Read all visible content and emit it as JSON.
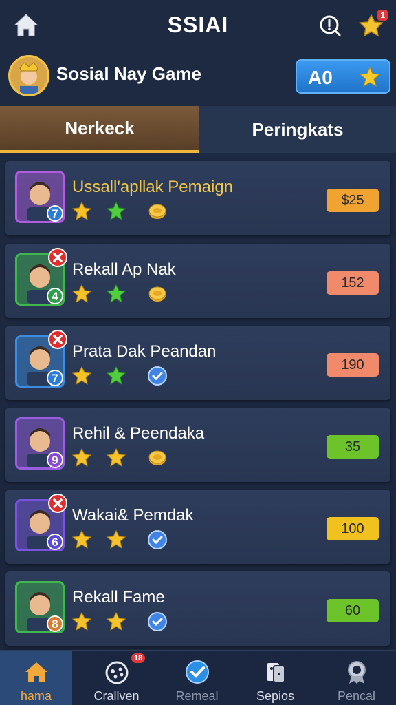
{
  "header": {
    "title": "SSIAI",
    "notif_badge": "1"
  },
  "profile": {
    "game_name": "Sosial Nay Game",
    "coin_value": "A0"
  },
  "tabs": [
    {
      "label": "Nerkeck",
      "active": true
    },
    {
      "label": "Peringkats",
      "active": false
    }
  ],
  "players": [
    {
      "name": "Ussall'apllak Pemaign",
      "level": "7",
      "score": "$25",
      "score_color": "#f1a331",
      "name_color": "#f2c84a",
      "has_x": false,
      "frame": "#b25ce0",
      "lvl_color": "#2a7dd8",
      "icons": [
        "star-gold",
        "star-green",
        "coin-gold"
      ]
    },
    {
      "name": "Rekall Ap Nak",
      "level": "4",
      "score": "152",
      "score_color": "#f08a6a",
      "name_color": "#ffffff",
      "has_x": true,
      "frame": "#3eb84a",
      "lvl_color": "#2ba048",
      "icons": [
        "star-gold",
        "star-green",
        "coin-gold"
      ]
    },
    {
      "name": "Prata Dak Peandan",
      "level": "7",
      "score": "190",
      "score_color": "#f08a6a",
      "name_color": "#ffffff",
      "has_x": true,
      "frame": "#3a8de0",
      "lvl_color": "#2a7dd8",
      "icons": [
        "star-gold",
        "star-green",
        "check-blue"
      ]
    },
    {
      "name": "Rehil & Peendaka",
      "level": "9",
      "score": "35",
      "score_color": "#6cc42a",
      "name_color": "#ffffff",
      "has_x": false,
      "frame": "#9a5ce0",
      "lvl_color": "#8a48d8",
      "icons": [
        "star-gold",
        "star-gold",
        "coin-gold"
      ]
    },
    {
      "name": "Wakai& Pemdak",
      "level": "6",
      "score": "100",
      "score_color": "#f1c21f",
      "name_color": "#ffffff",
      "has_x": true,
      "frame": "#7a54e0",
      "lvl_color": "#5a48d8",
      "icons": [
        "star-gold",
        "star-gold",
        "check-blue"
      ]
    },
    {
      "name": "Rekall Fame",
      "level": "8",
      "score": "60",
      "score_color": "#6cc42a",
      "name_color": "#ffffff",
      "has_x": false,
      "frame": "#3eb84a",
      "lvl_color": "#e07a2a",
      "icons": [
        "star-gold",
        "star-gold",
        "check-blue"
      ]
    }
  ],
  "nav": [
    {
      "label": "hama",
      "icon": "home-icon",
      "active": true
    },
    {
      "label": "Crallven",
      "icon": "gamepad-icon",
      "active": false,
      "badge": "18"
    },
    {
      "label": "Remeal",
      "icon": "check-circle-icon",
      "active": false
    },
    {
      "label": "Sepios",
      "icon": "cards-icon",
      "active": false
    },
    {
      "label": "Pencal",
      "icon": "medal-icon",
      "active": false
    }
  ],
  "colors": {
    "accent": "#f2b63a",
    "background": "#1f2c44",
    "coin_box": "#2b86e0"
  }
}
